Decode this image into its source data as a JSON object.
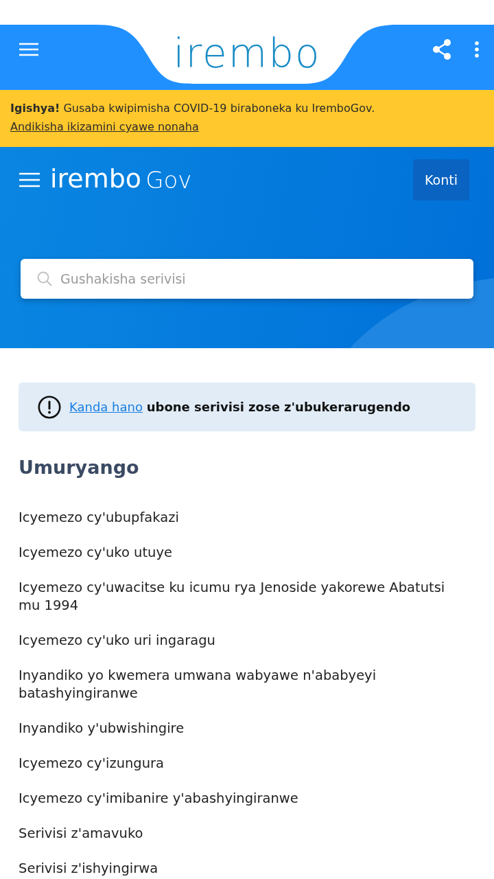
{
  "app_bar": {
    "logo": "irembo"
  },
  "notice": {
    "text": "**Igishya!** Gusaba kwipimisha COVID-19 biraboneka ku IremboGov.",
    "link": "Andikisha ikizamini cyawe nonaha"
  },
  "site_header": {
    "logo": "irembo",
    "logo_suffix": "Gov",
    "account_button": "Konti"
  },
  "search": {
    "placeholder": "Gushakisha serivisi"
  },
  "info": {
    "link": "Kanda hano",
    "text": "ubone serivisi zose z'ubukerarugendo"
  },
  "section": {
    "title": "Umuryango",
    "items": [
      "Icyemezo cy'ubupfakazi",
      "Icyemezo cy'uko utuye",
      "Icyemezo cy'uwacitse ku icumu rya Jenoside yakorewe Abatutsi mu 1994",
      "Icyemezo cy'uko uri ingaragu",
      "Inyandiko yo kwemera umwana wabyawe n'ababyeyi batashyingiranwe",
      "Inyandiko y'ubwishingire",
      "Icyemezo cy'izungura",
      "Icyemezo cy'imibanire y'abashyingiranwe",
      "Serivisi z'amavuko",
      "Serivisi z'ishyingirwa"
    ]
  }
}
